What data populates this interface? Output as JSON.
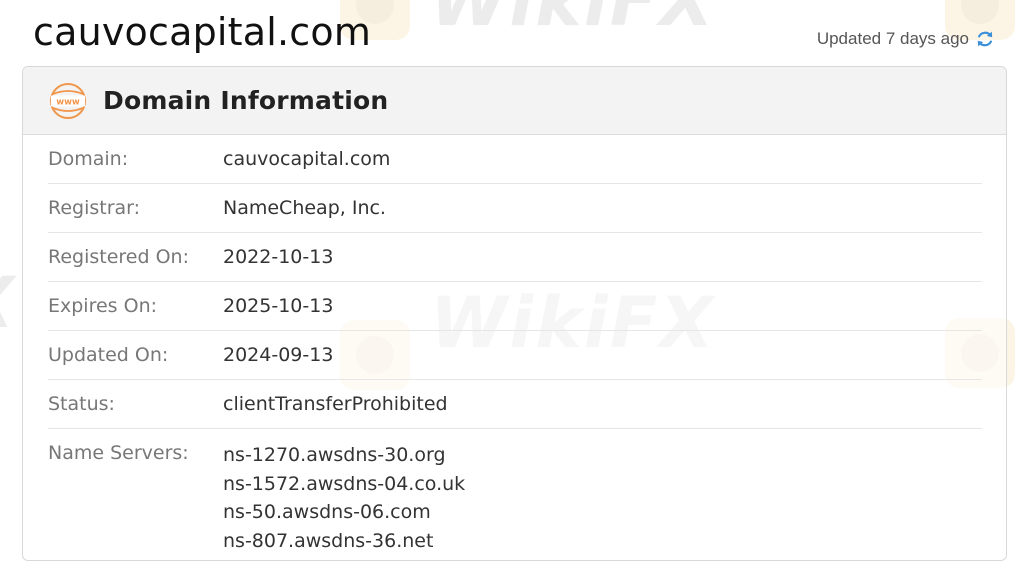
{
  "header": {
    "site_title": "cauvocapital.com",
    "updated_text": "Updated 7 days ago",
    "refresh_icon": "refresh-icon"
  },
  "card": {
    "icon": "www-icon",
    "title": "Domain Information",
    "rows": [
      {
        "label": "Domain:",
        "value": "cauvocapital.com"
      },
      {
        "label": "Registrar:",
        "value": "NameCheap, Inc."
      },
      {
        "label": "Registered On:",
        "value": "2022-10-13"
      },
      {
        "label": "Expires On:",
        "value": "2025-10-13"
      },
      {
        "label": "Updated On:",
        "value": "2024-09-13"
      },
      {
        "label": "Status:",
        "value": "clientTransferProhibited"
      }
    ],
    "name_servers": {
      "label": "Name Servers:",
      "values": [
        "ns-1270.awsdns-30.org",
        "ns-1572.awsdns-04.co.uk",
        "ns-50.awsdns-06.com",
        "ns-807.awsdns-36.net"
      ]
    }
  },
  "watermark": {
    "text": "WikiFX"
  },
  "colors": {
    "accent_orange": "#f0954a",
    "refresh_blue": "#3b8fd9",
    "header_bg": "#f2f2f2",
    "label_gray": "#777777"
  }
}
